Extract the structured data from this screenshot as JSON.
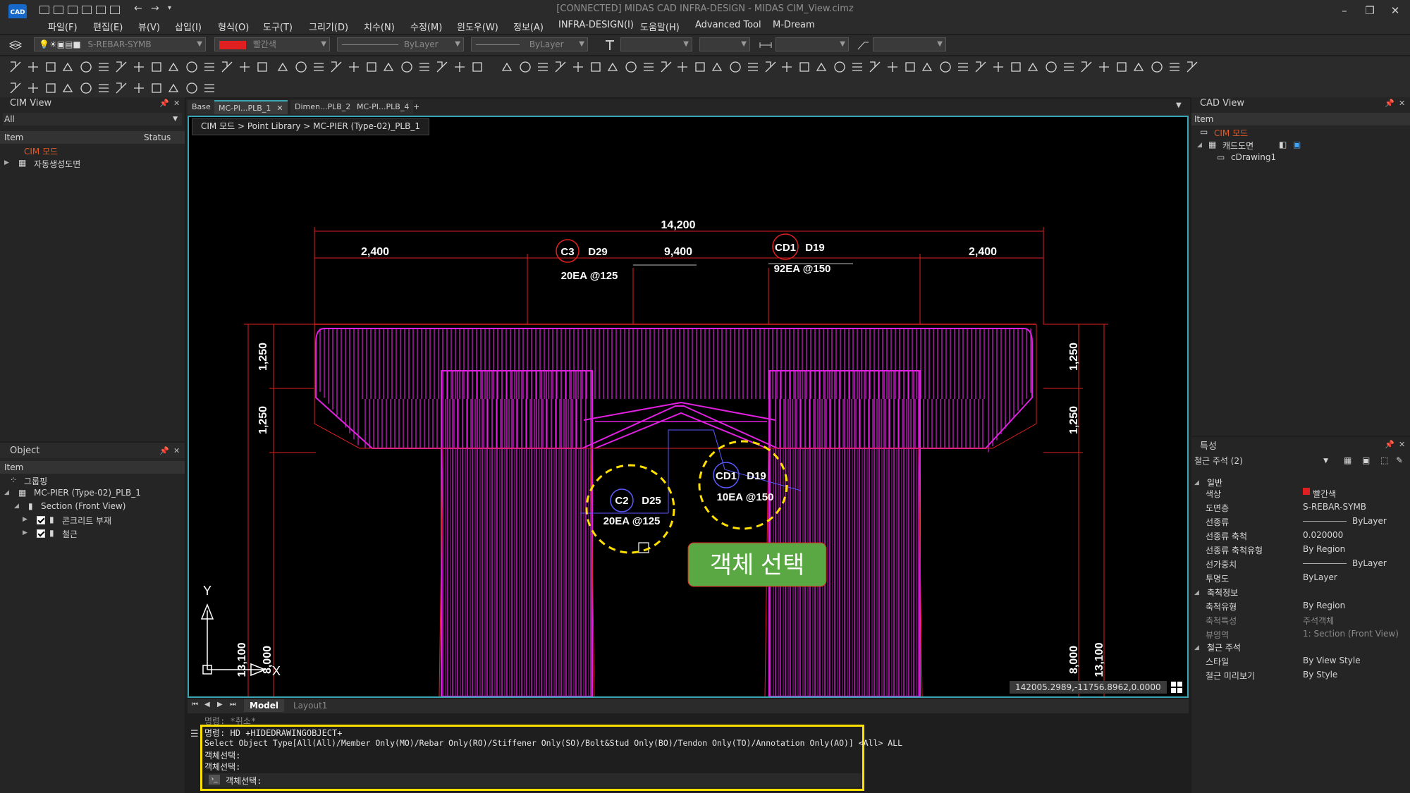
{
  "titlebar": {
    "logo_text": "CAD",
    "title": "[CONNECTED] MIDAS CAD INFRA-DESIGN - MIDAS CIM_View.cimz",
    "minimize": "–",
    "restore": "❐",
    "close": "✕"
  },
  "menu": [
    "파일(F)",
    "편집(E)",
    "뷰(V)",
    "삽입(I)",
    "형식(O)",
    "도구(T)",
    "그리기(D)",
    "치수(N)",
    "수정(M)",
    "윈도우(W)",
    "정보(A)",
    "INFRA-DESIGN(I)",
    "도움말(H)",
    "Advanced Tool",
    "M-Dream"
  ],
  "properties_bar": {
    "layer": "S-REBAR-SYMB",
    "color_name": "빨간색",
    "linetype": "ByLayer",
    "lineweight": "ByLayer"
  },
  "left_panel": {
    "title": "CIM View",
    "filter": "All",
    "col_item": "Item",
    "col_status": "Status",
    "root": "CIM 모드",
    "child": "자동생성도면"
  },
  "object_panel": {
    "title": "Object",
    "col_item": "Item",
    "grouping": "그룹핑",
    "model": "MC-PIER (Type-02)_PLB_1",
    "section": "Section (Front View)",
    "concrete": "콘크리트 부재",
    "rebar": "철근"
  },
  "tabs": [
    "Base",
    "MC-PI...PLB_1",
    "Dimen...PLB_2",
    "MC-PI...PLB_4"
  ],
  "tab_add": "+",
  "breadcrumb": "CIM 모드 > Point Library > MC-PIER (Type-02)_PLB_1",
  "drawing": {
    "dim_total": "14,200",
    "dim_left": "2,400",
    "dim_mid": "9,400",
    "dim_right": "2,400",
    "dim_v1": "1,250",
    "dim_v2": "1,250",
    "dim_v3": "13,100",
    "dim_v4": "8,000",
    "c3_tag": "C3",
    "c3_size": "D29",
    "c3_spacing": "20EA @125",
    "cd1_tag": "CD1",
    "cd1_size": "D19",
    "cd1_spacing": "92EA @150",
    "c2_tag": "C2",
    "c2_size": "D25",
    "c2_spacing": "20EA @125",
    "cd1b_tag": "CD1",
    "cd1b_size": "D19",
    "cd1b_spacing": "10EA @150",
    "axis_y": "Y",
    "axis_x": "X",
    "callout": "객체 선택"
  },
  "coords": "142005.2989,-11756.8962,0.0000",
  "layout_tabs": [
    "Model",
    "Layout1"
  ],
  "right_top": {
    "title": "CAD View",
    "col_item": "Item",
    "root": "CIM 모드",
    "child": "캐드도면",
    "grandchild": "cDrawing1"
  },
  "props": {
    "title": "특성",
    "selector": "철근 주석 (2)",
    "sections": [
      "일반",
      "축척정보",
      "철근 주석"
    ],
    "general": [
      {
        "k": "색상",
        "v": "빨간색"
      },
      {
        "k": "도면층",
        "v": "S-REBAR-SYMB"
      },
      {
        "k": "선종류",
        "v": "ByLayer"
      },
      {
        "k": "선종류 축척",
        "v": "0.020000"
      },
      {
        "k": "선종류 축척유형",
        "v": "By Region"
      },
      {
        "k": "선가중치",
        "v": "ByLayer"
      },
      {
        "k": "투명도",
        "v": "ByLayer"
      }
    ],
    "scale": [
      {
        "k": "축척유형",
        "v": "By Region"
      },
      {
        "k": "축척특성",
        "v": "주석객체"
      },
      {
        "k": "뷰영역",
        "v": "1: Section (Front View)"
      }
    ],
    "rebar": [
      {
        "k": "스타일",
        "v": "By View Style"
      },
      {
        "k": "철근 미리보기",
        "v": "By Style"
      }
    ]
  },
  "command": {
    "prev": "명령: *취소*",
    "line1": "명령: HD +HIDEDRAWINGOBJECT+",
    "line2": "Select Object Type[All(All)/Member Only(MO)/Rebar Only(RO)/Stiffener Only(SO)/Bolt&Stud Only(BO)/Tendon Only(TO)/Annotation Only(AO)] <All> ALL",
    "line3": "객체선택:",
    "line4": "객체선택:",
    "prompt": "객체선택:"
  },
  "colors": {
    "accent": "#3aa6b3",
    "rebar": "#e020e0",
    "dim_red": "#e02020",
    "highlight": "#ffe000",
    "callout": "#5aa843"
  }
}
